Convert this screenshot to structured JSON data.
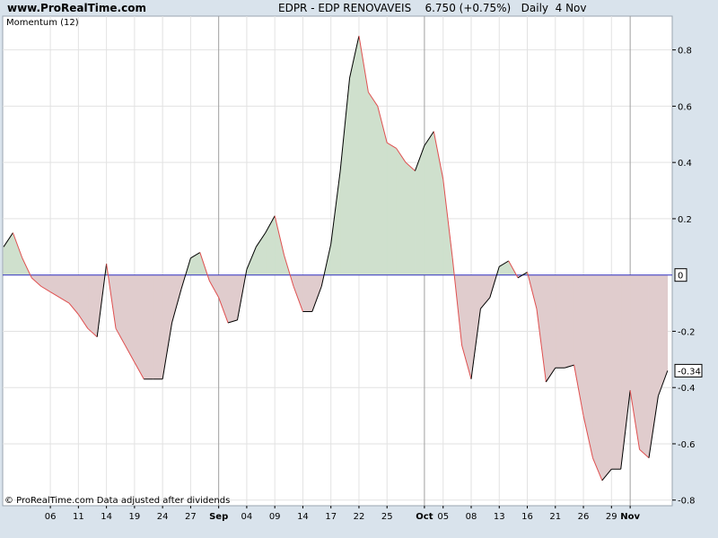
{
  "header": {
    "site": "www.ProRealTime.com",
    "title": "EDPR - EDP RENOVAVEIS",
    "price": "6.750 (+0.75%)",
    "period": "Daily  4 Nov"
  },
  "footer": {
    "credit": "© ProRealTime.com  Data adjusted after dividends"
  },
  "chart_data": {
    "type": "area",
    "title": "Momentum (12)",
    "ylim": [
      -0.82,
      0.92
    ],
    "y_ticks": [
      0.8,
      0.6,
      0.4,
      0.2,
      -0.2,
      -0.4,
      -0.6,
      -0.8
    ],
    "zero_label": "0",
    "last_label": "-0.34",
    "x_ticks": [
      {
        "label": "06",
        "i": 5,
        "bold": false
      },
      {
        "label": "11",
        "i": 8,
        "bold": false
      },
      {
        "label": "14",
        "i": 11,
        "bold": false
      },
      {
        "label": "19",
        "i": 14,
        "bold": false
      },
      {
        "label": "24",
        "i": 17,
        "bold": false
      },
      {
        "label": "27",
        "i": 20,
        "bold": false
      },
      {
        "label": "Sep",
        "i": 23,
        "bold": true
      },
      {
        "label": "04",
        "i": 26,
        "bold": false
      },
      {
        "label": "09",
        "i": 29,
        "bold": false
      },
      {
        "label": "14",
        "i": 32,
        "bold": false
      },
      {
        "label": "17",
        "i": 35,
        "bold": false
      },
      {
        "label": "22",
        "i": 38,
        "bold": false
      },
      {
        "label": "25",
        "i": 41,
        "bold": false
      },
      {
        "label": "Oct",
        "i": 45,
        "bold": true
      },
      {
        "label": "05",
        "i": 47,
        "bold": false
      },
      {
        "label": "08",
        "i": 50,
        "bold": false
      },
      {
        "label": "13",
        "i": 53,
        "bold": false
      },
      {
        "label": "16",
        "i": 56,
        "bold": false
      },
      {
        "label": "21",
        "i": 59,
        "bold": false
      },
      {
        "label": "26",
        "i": 62,
        "bold": false
      },
      {
        "label": "29",
        "i": 65,
        "bold": false
      },
      {
        "label": "Nov",
        "i": 67,
        "bold": true
      }
    ],
    "month_lines": [
      23,
      45,
      67
    ],
    "series": [
      {
        "values": [
          0.1,
          0.15,
          0.06,
          -0.01,
          -0.04,
          -0.06,
          -0.08,
          -0.1,
          -0.14,
          -0.19,
          -0.22,
          0.04,
          -0.19,
          -0.25,
          -0.31,
          -0.37,
          -0.37,
          -0.37,
          -0.17,
          -0.05,
          0.06,
          0.08,
          -0.02,
          -0.08,
          -0.17,
          -0.16,
          0.02,
          0.1,
          0.15,
          0.21,
          0.07,
          -0.04,
          -0.13,
          -0.13,
          -0.04,
          0.11,
          0.37,
          0.7,
          0.85,
          0.65,
          0.6,
          0.47,
          0.45,
          0.4,
          0.37,
          0.46,
          0.51,
          0.34,
          0.06,
          -0.25,
          -0.37,
          -0.12,
          -0.08,
          0.03,
          0.05,
          -0.01,
          0.01,
          -0.12,
          -0.38,
          -0.33,
          -0.33,
          -0.32,
          -0.5,
          -0.65,
          -0.73,
          -0.69,
          -0.69,
          -0.41,
          -0.62,
          -0.65,
          -0.43,
          -0.34
        ],
        "fill_pos": "#cfe0cd",
        "fill_neg": "#e0cccd",
        "line_rising": "#000000",
        "line_falling": "#e05050",
        "zero_line": "#3030c0"
      }
    ]
  }
}
